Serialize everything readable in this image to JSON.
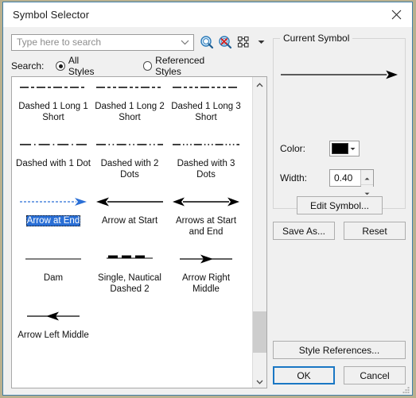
{
  "window": {
    "title": "Symbol Selector",
    "close_icon": "close-icon"
  },
  "search": {
    "placeholder": "Type here to search",
    "value": "",
    "dropdown_icon": "chevron-down-icon",
    "tools": [
      {
        "name": "search-icon",
        "label": "Search"
      },
      {
        "name": "clear-search-icon",
        "label": "Clear Search"
      },
      {
        "name": "view-options-icon",
        "label": "View"
      }
    ],
    "tools_dropdown_icon": "caret-down-icon",
    "label": "Search:",
    "options": [
      {
        "label": "All Styles",
        "selected": true
      },
      {
        "label": "Referenced Styles",
        "selected": false
      }
    ]
  },
  "symbol_list": {
    "selected": "Arrow at End",
    "rows": [
      {
        "items": [
          {
            "label": "",
            "preview": "dashed-1-long-1-short",
            "clipped": true
          },
          {
            "label": "",
            "preview": "dashed-1-long-2-short",
            "clipped": true
          },
          {
            "label": "",
            "preview": "dashed-1-long-3-short",
            "clipped": true
          }
        ]
      },
      {
        "items": [
          {
            "label": "Dashed 1 Long 1 Short",
            "preview": "dashed-1-long-1-short"
          },
          {
            "label": "Dashed 1 Long 2 Short",
            "preview": "dashed-1-long-2-short"
          },
          {
            "label": "Dashed 1 Long 3 Short",
            "preview": "dashed-1-long-3-short"
          }
        ]
      },
      {
        "items": [
          {
            "label": "Dashed with 1 Dot",
            "preview": "dash-dot"
          },
          {
            "label": "Dashed with 2 Dots",
            "preview": "dash-dot-dot"
          },
          {
            "label": "Dashed with 3 Dots",
            "preview": "dash-dot-dot-dot"
          }
        ]
      },
      {
        "items": [
          {
            "label": "Arrow at End",
            "preview": "arrow-at-end",
            "selected": true
          },
          {
            "label": "Arrow at Start",
            "preview": "arrow-at-start"
          },
          {
            "label": "Arrows at Start and End",
            "preview": "arrows-at-start-and-end"
          }
        ]
      },
      {
        "items": [
          {
            "label": "Dam",
            "preview": "dam-line"
          },
          {
            "label": "Single, Nautical Dashed 2",
            "preview": "nautical-dashed-2"
          },
          {
            "label": "Arrow Right Middle",
            "preview": "arrow-right-middle"
          }
        ]
      },
      {
        "items": [
          {
            "label": "Arrow Left Middle",
            "preview": "arrow-left-middle"
          }
        ]
      }
    ],
    "scrollbar": {
      "up_icon": "scroll-up-icon",
      "down_icon": "scroll-down-icon"
    }
  },
  "current_symbol": {
    "group_title": "Current Symbol",
    "preview": "arrow-at-end-large",
    "color_label": "Color:",
    "color_value": "#000000",
    "color_dropdown_icon": "caret-down-icon",
    "width_label": "Width:",
    "width_value": "0.40",
    "spinner_up_icon": "spinner-up-icon",
    "spinner_down_icon": "spinner-down-icon",
    "edit_symbol_label": "Edit Symbol...",
    "save_as_label": "Save As...",
    "reset_label": "Reset"
  },
  "footer": {
    "style_references_label": "Style References...",
    "ok_label": "OK",
    "cancel_label": "Cancel",
    "resize_grip_icon": "resize-grip-icon"
  },
  "colors": {
    "accent": "#1a77c4",
    "selection": "#2a6fd6",
    "dialog_bg": "#f0f0f0",
    "list_bg": "#ffffff",
    "border": "#3f7ea8"
  }
}
